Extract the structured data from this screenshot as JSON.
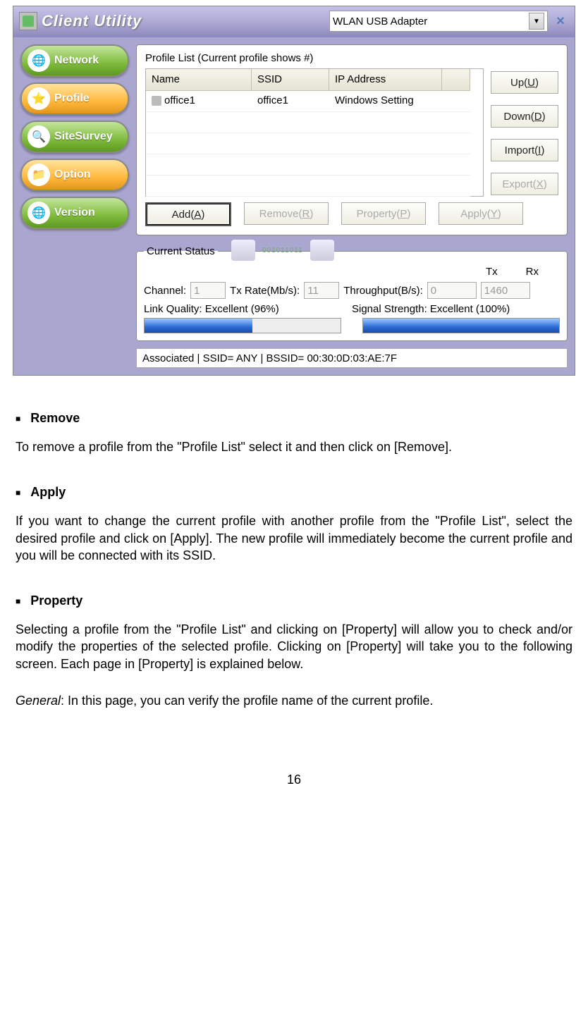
{
  "app": {
    "title": "Client Utility",
    "adapter": "WLAN USB Adapter",
    "close_icon": "×"
  },
  "sidebar": {
    "items": [
      {
        "label": "Network",
        "style": "green",
        "icon_name": "globe-icon"
      },
      {
        "label": "Profile",
        "style": "orange",
        "icon_name": "star-icon"
      },
      {
        "label": "SiteSurvey",
        "style": "green",
        "icon_name": "search-icon"
      },
      {
        "label": "Option",
        "style": "orange",
        "icon_name": "folder-icon"
      },
      {
        "label": "Version",
        "style": "green",
        "icon_name": "globe-icon"
      }
    ]
  },
  "profile": {
    "panel_title": "Profile List (Current profile shows #)",
    "columns": {
      "name": "Name",
      "ssid": "SSID",
      "ip": "IP Address"
    },
    "rows": [
      {
        "name": "office1",
        "ssid": "office1",
        "ip": "Windows Setting"
      }
    ],
    "side_buttons": {
      "up": "Up(",
      "up_u": "U",
      "up_end": ")",
      "down": "Down(",
      "down_u": "D",
      "down_end": ")",
      "import": "Import(",
      "import_u": "I",
      "import_end": ")",
      "export": "Export(",
      "export_u": "X",
      "export_end": ")"
    },
    "bottom_buttons": {
      "add": "Add(",
      "add_u": "A",
      "add_end": ")",
      "remove": "Remove(",
      "remove_u": "R",
      "remove_end": ")",
      "property": "Property(",
      "property_u": "P",
      "property_end": ")",
      "apply": "Apply(",
      "apply_u": "Y",
      "apply_end": ")"
    }
  },
  "status": {
    "legend": "Current Status",
    "bits_text": "001011011",
    "tx_label": "Tx",
    "rx_label": "Rx",
    "channel_label": "Channel:",
    "channel_value": "1",
    "txrate_label": "Tx Rate(Mb/s):",
    "txrate_value": "11",
    "throughput_label": "Throughput(B/s):",
    "throughput_tx": "0",
    "throughput_rx": "1460",
    "linkq_label": "Link Quality:  Excellent (96%)",
    "sigstr_label": "Signal Strength:  Excellent (100%)",
    "assoc_text": "Associated | SSID= ANY              | BSSID= 00:30:0D:03:AE:7F",
    "bar1_width": "55%",
    "bar2_width": "100%"
  },
  "doc": {
    "remove": {
      "header": "Remove",
      "body": "To remove a profile from the \"Profile List\" select it and then click on [Remove]."
    },
    "apply": {
      "header": "Apply",
      "body": "If you want to change the current profile with another profile from the \"Profile List\", select the desired profile and click on [Apply]. The new profile will immediately become the current profile and you will be connected with its SSID."
    },
    "property": {
      "header": "Property",
      "body": "Selecting a profile from the \"Profile List\" and clicking on [Property] will allow you to check and/or modify the properties of the selected profile. Clicking on [Property] will take you to the following screen. Each page in [Property] is explained below.",
      "general_label": "General",
      "general_text": ": In this page, you can verify the profile name of the current profile."
    },
    "page_number": "16"
  }
}
